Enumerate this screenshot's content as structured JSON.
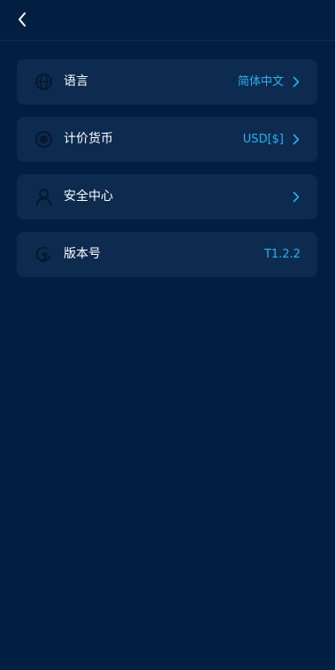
{
  "header": {
    "back_icon": "chevron-left-icon"
  },
  "settings": {
    "items": [
      {
        "label": "语言",
        "value": "简体中文",
        "icon": "globe-icon",
        "has_chevron": true
      },
      {
        "label": "计价货币",
        "value": "USD[$]",
        "icon": "coin-icon",
        "has_chevron": true
      },
      {
        "label": "安全中心",
        "value": "",
        "icon": "user-shield-icon",
        "has_chevron": true
      },
      {
        "label": "版本号",
        "value": "T1.2.2",
        "icon": "version-icon",
        "has_chevron": false
      }
    ]
  },
  "colors": {
    "background": "#011f41",
    "card": "#0d2b4f",
    "accent": "#22b3f0",
    "icon_muted": "#06192f",
    "text": "#ffffff"
  }
}
